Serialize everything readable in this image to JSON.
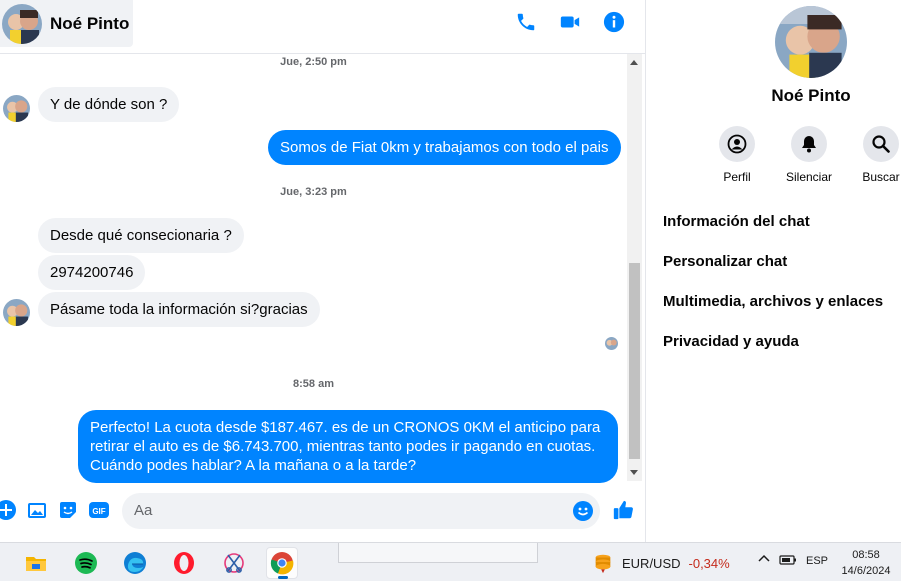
{
  "contact": {
    "name": "Noé Pinto"
  },
  "header_icons": [
    "phone-icon",
    "video-icon",
    "info-icon"
  ],
  "messages": [
    {
      "type": "timestamp",
      "text": "Jue, 2:50 pm"
    },
    {
      "type": "in",
      "text": "Y de dónde son ?"
    },
    {
      "type": "out",
      "text": "Somos de Fiat 0km y trabajamos con todo el pais"
    },
    {
      "type": "timestamp",
      "text": "Jue, 3:23 pm"
    },
    {
      "type": "in",
      "text": "Desde qué consecionaria ?"
    },
    {
      "type": "in",
      "text": "2974200746"
    },
    {
      "type": "in",
      "text": "Pásame toda la información si?gracias"
    },
    {
      "type": "timestamp",
      "text": "8:58 am"
    },
    {
      "type": "out",
      "text": "Perfecto! La cuota desde $187.467. es de un CRONOS 0KM el anticipo para retirar el auto es de $6.743.700, mientras tanto podes ir pagando en cuotas. Cuándo podes hablar? A la mañana o a la tarde?"
    }
  ],
  "composer": {
    "placeholder": "Aa",
    "tools": [
      "plus-icon",
      "image-icon",
      "sticker-icon",
      "gif-icon"
    ],
    "gif_label": "GIF"
  },
  "panel": {
    "name": "Noé Pinto",
    "actions": [
      {
        "icon": "profile-icon",
        "label": "Perfil"
      },
      {
        "icon": "bell-icon",
        "label": "Silenciar"
      },
      {
        "icon": "search-icon",
        "label": "Buscar"
      }
    ],
    "menu": [
      "Información del chat",
      "Personalizar chat",
      "Multimedia, archivos y enlaces",
      "Privacidad y ayuda"
    ]
  },
  "taskbar": {
    "apps": [
      "file-explorer-icon",
      "spotify-icon",
      "edge-icon",
      "opera-icon",
      "snipping-tool-icon",
      "chrome-icon"
    ],
    "ticker": {
      "symbol": "EUR/USD",
      "change": "-0,34%"
    },
    "language": "ESP",
    "time": "08:58",
    "date": "14/6/2024"
  },
  "colors": {
    "messenger_blue": "#0084ff",
    "incoming_bg": "#f0f2f5",
    "loss_red": "#c42b1c"
  }
}
